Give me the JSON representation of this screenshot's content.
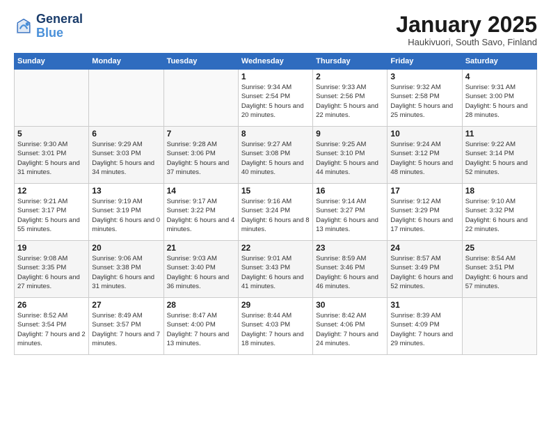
{
  "logo": {
    "line1": "General",
    "line2": "Blue"
  },
  "title": "January 2025",
  "location": "Haukivuori, South Savo, Finland",
  "weekdays": [
    "Sunday",
    "Monday",
    "Tuesday",
    "Wednesday",
    "Thursday",
    "Friday",
    "Saturday"
  ],
  "weeks": [
    [
      {
        "day": "",
        "sunrise": "",
        "sunset": "",
        "daylight": ""
      },
      {
        "day": "",
        "sunrise": "",
        "sunset": "",
        "daylight": ""
      },
      {
        "day": "",
        "sunrise": "",
        "sunset": "",
        "daylight": ""
      },
      {
        "day": "1",
        "sunrise": "Sunrise: 9:34 AM",
        "sunset": "Sunset: 2:54 PM",
        "daylight": "Daylight: 5 hours and 20 minutes."
      },
      {
        "day": "2",
        "sunrise": "Sunrise: 9:33 AM",
        "sunset": "Sunset: 2:56 PM",
        "daylight": "Daylight: 5 hours and 22 minutes."
      },
      {
        "day": "3",
        "sunrise": "Sunrise: 9:32 AM",
        "sunset": "Sunset: 2:58 PM",
        "daylight": "Daylight: 5 hours and 25 minutes."
      },
      {
        "day": "4",
        "sunrise": "Sunrise: 9:31 AM",
        "sunset": "Sunset: 3:00 PM",
        "daylight": "Daylight: 5 hours and 28 minutes."
      }
    ],
    [
      {
        "day": "5",
        "sunrise": "Sunrise: 9:30 AM",
        "sunset": "Sunset: 3:01 PM",
        "daylight": "Daylight: 5 hours and 31 minutes."
      },
      {
        "day": "6",
        "sunrise": "Sunrise: 9:29 AM",
        "sunset": "Sunset: 3:03 PM",
        "daylight": "Daylight: 5 hours and 34 minutes."
      },
      {
        "day": "7",
        "sunrise": "Sunrise: 9:28 AM",
        "sunset": "Sunset: 3:06 PM",
        "daylight": "Daylight: 5 hours and 37 minutes."
      },
      {
        "day": "8",
        "sunrise": "Sunrise: 9:27 AM",
        "sunset": "Sunset: 3:08 PM",
        "daylight": "Daylight: 5 hours and 40 minutes."
      },
      {
        "day": "9",
        "sunrise": "Sunrise: 9:25 AM",
        "sunset": "Sunset: 3:10 PM",
        "daylight": "Daylight: 5 hours and 44 minutes."
      },
      {
        "day": "10",
        "sunrise": "Sunrise: 9:24 AM",
        "sunset": "Sunset: 3:12 PM",
        "daylight": "Daylight: 5 hours and 48 minutes."
      },
      {
        "day": "11",
        "sunrise": "Sunrise: 9:22 AM",
        "sunset": "Sunset: 3:14 PM",
        "daylight": "Daylight: 5 hours and 52 minutes."
      }
    ],
    [
      {
        "day": "12",
        "sunrise": "Sunrise: 9:21 AM",
        "sunset": "Sunset: 3:17 PM",
        "daylight": "Daylight: 5 hours and 55 minutes."
      },
      {
        "day": "13",
        "sunrise": "Sunrise: 9:19 AM",
        "sunset": "Sunset: 3:19 PM",
        "daylight": "Daylight: 6 hours and 0 minutes."
      },
      {
        "day": "14",
        "sunrise": "Sunrise: 9:17 AM",
        "sunset": "Sunset: 3:22 PM",
        "daylight": "Daylight: 6 hours and 4 minutes."
      },
      {
        "day": "15",
        "sunrise": "Sunrise: 9:16 AM",
        "sunset": "Sunset: 3:24 PM",
        "daylight": "Daylight: 6 hours and 8 minutes."
      },
      {
        "day": "16",
        "sunrise": "Sunrise: 9:14 AM",
        "sunset": "Sunset: 3:27 PM",
        "daylight": "Daylight: 6 hours and 13 minutes."
      },
      {
        "day": "17",
        "sunrise": "Sunrise: 9:12 AM",
        "sunset": "Sunset: 3:29 PM",
        "daylight": "Daylight: 6 hours and 17 minutes."
      },
      {
        "day": "18",
        "sunrise": "Sunrise: 9:10 AM",
        "sunset": "Sunset: 3:32 PM",
        "daylight": "Daylight: 6 hours and 22 minutes."
      }
    ],
    [
      {
        "day": "19",
        "sunrise": "Sunrise: 9:08 AM",
        "sunset": "Sunset: 3:35 PM",
        "daylight": "Daylight: 6 hours and 27 minutes."
      },
      {
        "day": "20",
        "sunrise": "Sunrise: 9:06 AM",
        "sunset": "Sunset: 3:38 PM",
        "daylight": "Daylight: 6 hours and 31 minutes."
      },
      {
        "day": "21",
        "sunrise": "Sunrise: 9:03 AM",
        "sunset": "Sunset: 3:40 PM",
        "daylight": "Daylight: 6 hours and 36 minutes."
      },
      {
        "day": "22",
        "sunrise": "Sunrise: 9:01 AM",
        "sunset": "Sunset: 3:43 PM",
        "daylight": "Daylight: 6 hours and 41 minutes."
      },
      {
        "day": "23",
        "sunrise": "Sunrise: 8:59 AM",
        "sunset": "Sunset: 3:46 PM",
        "daylight": "Daylight: 6 hours and 46 minutes."
      },
      {
        "day": "24",
        "sunrise": "Sunrise: 8:57 AM",
        "sunset": "Sunset: 3:49 PM",
        "daylight": "Daylight: 6 hours and 52 minutes."
      },
      {
        "day": "25",
        "sunrise": "Sunrise: 8:54 AM",
        "sunset": "Sunset: 3:51 PM",
        "daylight": "Daylight: 6 hours and 57 minutes."
      }
    ],
    [
      {
        "day": "26",
        "sunrise": "Sunrise: 8:52 AM",
        "sunset": "Sunset: 3:54 PM",
        "daylight": "Daylight: 7 hours and 2 minutes."
      },
      {
        "day": "27",
        "sunrise": "Sunrise: 8:49 AM",
        "sunset": "Sunset: 3:57 PM",
        "daylight": "Daylight: 7 hours and 7 minutes."
      },
      {
        "day": "28",
        "sunrise": "Sunrise: 8:47 AM",
        "sunset": "Sunset: 4:00 PM",
        "daylight": "Daylight: 7 hours and 13 minutes."
      },
      {
        "day": "29",
        "sunrise": "Sunrise: 8:44 AM",
        "sunset": "Sunset: 4:03 PM",
        "daylight": "Daylight: 7 hours and 18 minutes."
      },
      {
        "day": "30",
        "sunrise": "Sunrise: 8:42 AM",
        "sunset": "Sunset: 4:06 PM",
        "daylight": "Daylight: 7 hours and 24 minutes."
      },
      {
        "day": "31",
        "sunrise": "Sunrise: 8:39 AM",
        "sunset": "Sunset: 4:09 PM",
        "daylight": "Daylight: 7 hours and 29 minutes."
      },
      {
        "day": "",
        "sunrise": "",
        "sunset": "",
        "daylight": ""
      }
    ]
  ]
}
